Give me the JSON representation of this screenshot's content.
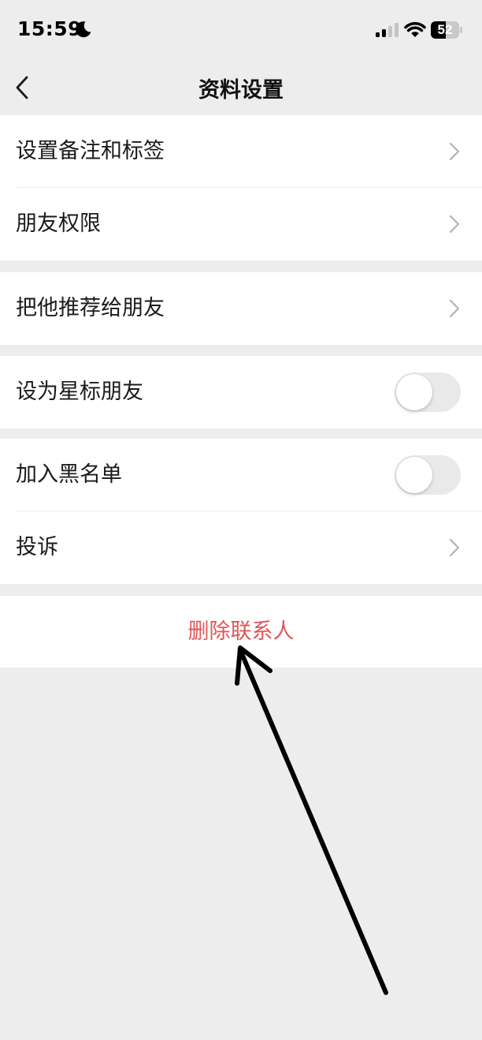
{
  "status_bar": {
    "time": "15:59",
    "battery_level": "52",
    "icons": [
      "moon-icon",
      "signal-icon",
      "wifi-icon",
      "battery-icon"
    ]
  },
  "nav": {
    "title": "资料设置",
    "back_icon": "chevron-left-icon"
  },
  "groups": [
    {
      "rows": [
        {
          "label": "设置备注和标签",
          "accessory": "chevron"
        },
        {
          "label": "朋友权限",
          "accessory": "chevron"
        }
      ]
    },
    {
      "rows": [
        {
          "label": "把他推荐给朋友",
          "accessory": "chevron"
        }
      ]
    },
    {
      "rows": [
        {
          "label": "设为星标朋友",
          "accessory": "toggle",
          "toggle_on": false
        }
      ]
    },
    {
      "rows": [
        {
          "label": "加入黑名单",
          "accessory": "toggle",
          "toggle_on": false
        },
        {
          "label": "投诉",
          "accessory": "chevron"
        }
      ]
    }
  ],
  "delete_contact": {
    "label": "删除联系人",
    "color": "#e0555a"
  },
  "colors": {
    "page_background": "#ededed",
    "row_background": "#ffffff",
    "toggle_off": "#e9e9ea",
    "chevron": "#b2b2b2",
    "annotation_arrow": "#000000"
  },
  "annotation": {
    "type": "arrow",
    "points_to": "delete-contact-button"
  }
}
